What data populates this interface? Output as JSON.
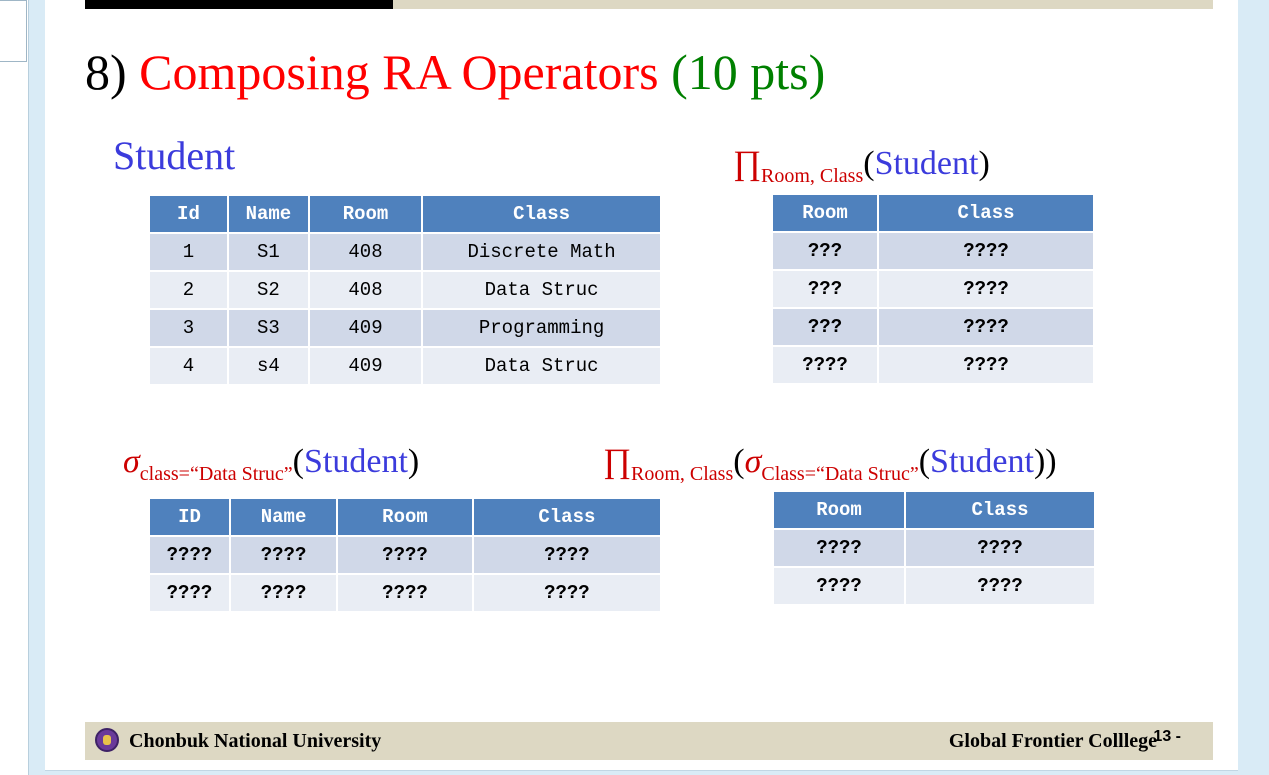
{
  "title": {
    "number": "8)",
    "main": "Composing RA Operators",
    "points": "(10 pts)"
  },
  "student_label": "Student",
  "student_table": {
    "headers": [
      "Id",
      "Name",
      "Room",
      "Class"
    ],
    "rows": [
      [
        "1",
        "S1",
        "408",
        "Discrete Math"
      ],
      [
        "2",
        "S2",
        "408",
        "Data Struc"
      ],
      [
        "3",
        "S3",
        "409",
        "Programming"
      ],
      [
        "4",
        "s4",
        "409",
        "Data Struc"
      ]
    ]
  },
  "projection_expr": {
    "op": "∏",
    "sub": "Room, Class",
    "arg": "Student"
  },
  "projection_table": {
    "headers": [
      "Room",
      "Class"
    ],
    "rows": [
      [
        "???",
        "????"
      ],
      [
        "???",
        "????"
      ],
      [
        "???",
        "????"
      ],
      [
        "????",
        "????"
      ]
    ]
  },
  "selection_expr": {
    "op": "σ",
    "sub": "class=“Data Struc”",
    "arg": "Student"
  },
  "selection_table": {
    "headers": [
      "ID",
      "Name",
      "Room",
      "Class"
    ],
    "rows": [
      [
        "????",
        "????",
        "????",
        "????"
      ],
      [
        "????",
        "????",
        "????",
        "????"
      ]
    ]
  },
  "composed_expr": {
    "op": "∏",
    "sub": "Room, Class",
    "inner_op": "σ",
    "inner_sub": "Class=“Data Struc”",
    "arg": "Student"
  },
  "composed_table": {
    "headers": [
      "Room",
      "Class"
    ],
    "rows": [
      [
        "????",
        "????"
      ],
      [
        "????",
        "????"
      ]
    ]
  },
  "footer": {
    "left": "Chonbuk  National  University",
    "right": "Global Frontier Colllege",
    "page": "13 -"
  },
  "colors": {
    "title_red": "#ff0000",
    "title_green": "#008000",
    "header_blue": "#4f81bd",
    "label_blue": "#3b3bdc",
    "footer_band": "#ddd8c3",
    "background": "#d9ebf6"
  }
}
